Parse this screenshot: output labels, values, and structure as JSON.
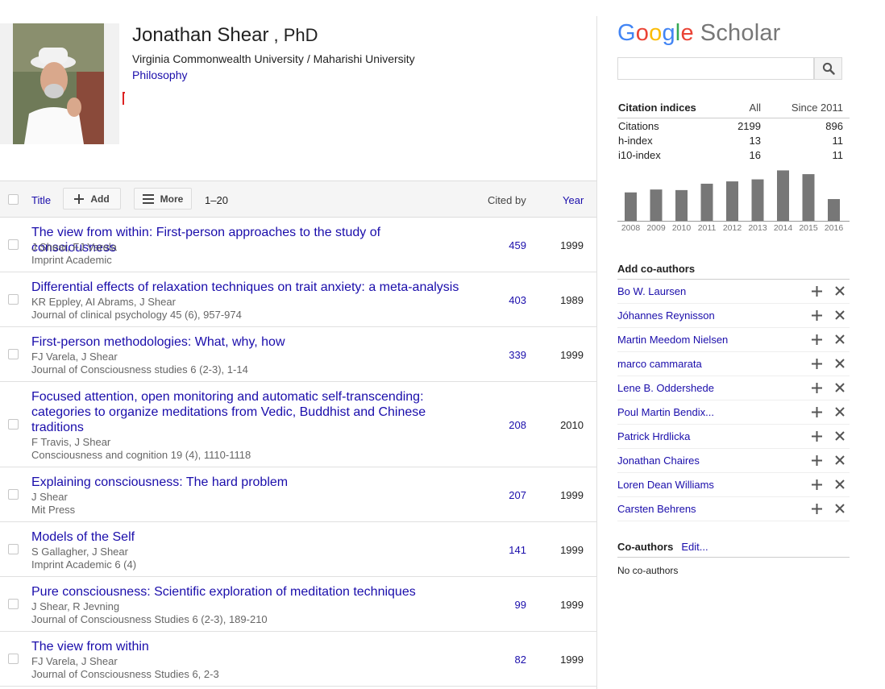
{
  "profile": {
    "name": "Jonathan Shear",
    "suffix": ", PhD",
    "affiliation": "Virginia Commonwealth University / Maharishi University",
    "field": "Philosophy"
  },
  "table": {
    "title_label": "Title",
    "add_label": "Add",
    "more_label": "More",
    "range": "1–20",
    "cited_label": "Cited by",
    "year_label": "Year"
  },
  "papers": [
    {
      "title": "The view from within: First-person approaches to the study of consciousness",
      "authors": "J Shear, FJ Varela",
      "venue": "Imprint Academic",
      "cites": "459",
      "year": "1999"
    },
    {
      "title": "Differential effects of relaxation techniques on trait anxiety: a meta-analysis",
      "authors": "KR Eppley, AI Abrams, J Shear",
      "venue": "Journal of clinical psychology 45 (6), 957-974",
      "cites": "403",
      "year": "1989"
    },
    {
      "title": "First-person methodologies: What, why, how",
      "authors": "FJ Varela, J Shear",
      "venue": "Journal of Consciousness studies 6 (2-3), 1-14",
      "cites": "339",
      "year": "1999"
    },
    {
      "title": "Focused attention, open monitoring and automatic self-transcending: categories to organize meditations from Vedic, Buddhist and Chinese traditions",
      "authors": "F Travis, J Shear",
      "venue": "Consciousness and cognition 19 (4), 1110-1118",
      "cites": "208",
      "year": "2010"
    },
    {
      "title": "Explaining consciousness: The hard problem",
      "authors": "J Shear",
      "venue": "Mit Press",
      "cites": "207",
      "year": "1999"
    },
    {
      "title": "Models of the Self",
      "authors": "S Gallagher, J Shear",
      "venue": "Imprint Academic 6 (4)",
      "cites": "141",
      "year": "1999"
    },
    {
      "title": "Pure consciousness: Scientific exploration of meditation techniques",
      "authors": "J Shear, R Jevning",
      "venue": "Journal of Consciousness Studies 6 (2-3), 189-210",
      "cites": "99",
      "year": "1999"
    },
    {
      "title": "The view from within",
      "authors": "FJ Varela, J Shear",
      "venue": "Journal of Consciousness Studies 6, 2-3",
      "cites": "82",
      "year": "1999"
    }
  ],
  "logo": {
    "google": "Google",
    "scholar": "Scholar",
    "colors": [
      "#4285F4",
      "#EA4335",
      "#FBBC05",
      "#4285F4",
      "#34A853",
      "#EA4335"
    ]
  },
  "citations": {
    "header": "Citation indices",
    "col_all": "All",
    "col_since": "Since 2011",
    "rows": [
      {
        "label": "Citations",
        "all": "2199",
        "since": "896"
      },
      {
        "label": "h-index",
        "all": "13",
        "since": "11"
      },
      {
        "label": "i10-index",
        "all": "16",
        "since": "11"
      }
    ]
  },
  "chart_data": {
    "type": "bar",
    "categories": [
      "2008",
      "2009",
      "2010",
      "2011",
      "2012",
      "2013",
      "2014",
      "2015",
      "2016"
    ],
    "values": [
      98,
      108,
      106,
      128,
      136,
      143,
      174,
      161,
      75
    ],
    "ylim": [
      0,
      200
    ],
    "bar_color": "#777777",
    "grid": false
  },
  "add_coauthors": {
    "header": "Add co-authors",
    "items": [
      "Bo W. Laursen",
      "Jóhannes Reynisson",
      "Martin Meedom Nielsen",
      "marco cammarata",
      "Lene B. Oddershede",
      "Poul Martin Bendix...",
      "Patrick Hrdlicka",
      "Jonathan Chaires",
      "Loren Dean Williams",
      "Carsten Behrens"
    ]
  },
  "coauthors": {
    "header": "Co-authors",
    "edit_label": "Edit...",
    "empty_text": "No co-authors"
  }
}
